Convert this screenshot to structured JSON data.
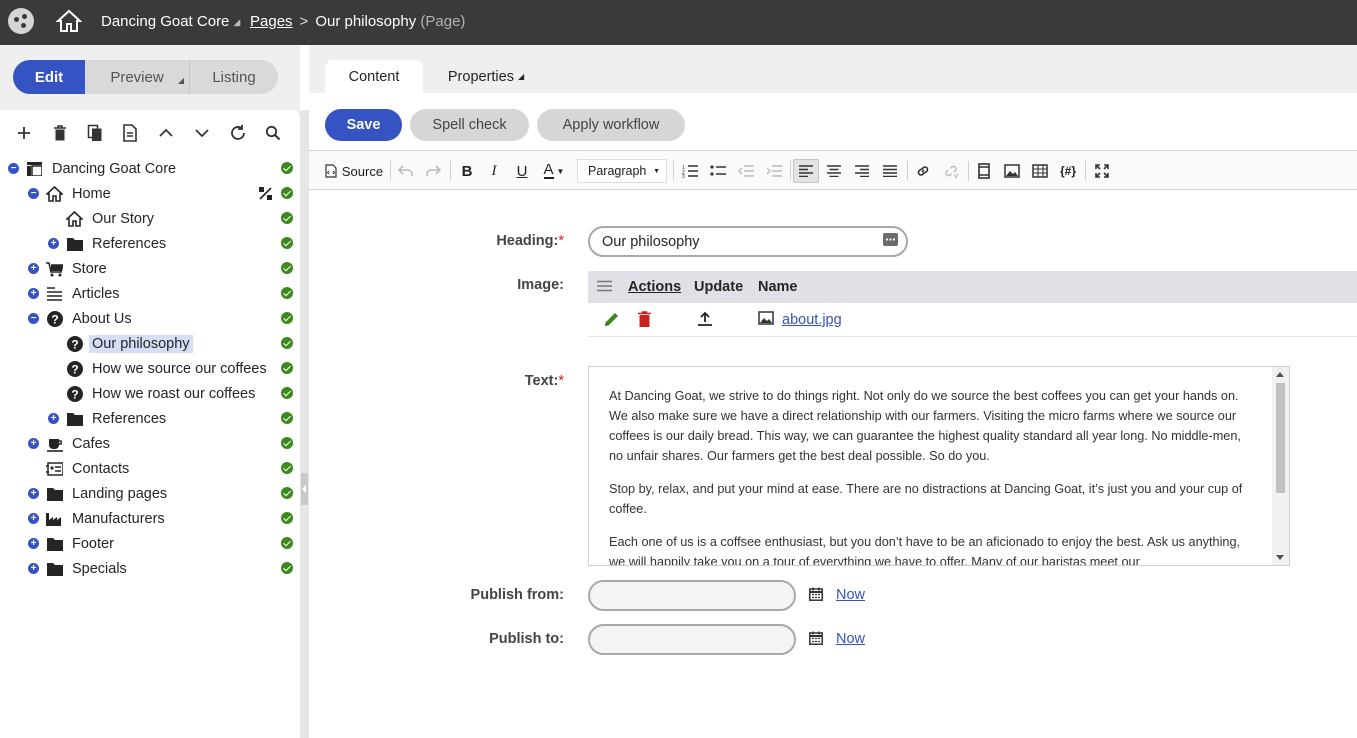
{
  "topbar": {
    "site_name": "Dancing Goat Core",
    "breadcrumb_pages": "Pages",
    "breadcrumb_current": "Our philosophy",
    "breadcrumb_kind": "(Page)"
  },
  "modes": {
    "edit": "Edit",
    "preview": "Preview",
    "listing": "Listing"
  },
  "tree": {
    "tools": [
      "plus-icon",
      "trash-icon",
      "copy-icon",
      "document-icon",
      "chevron-up-icon",
      "chevron-down-icon",
      "refresh-icon",
      "search-icon"
    ],
    "items": [
      {
        "label": "Dancing Goat Core",
        "icon": "site-icon"
      },
      {
        "label": "Home",
        "icon": "home-icon"
      },
      {
        "label": "Our Story",
        "icon": "home-icon"
      },
      {
        "label": "References",
        "icon": "folder-icon"
      },
      {
        "label": "Store",
        "icon": "cart-icon"
      },
      {
        "label": "Articles",
        "icon": "articles-icon"
      },
      {
        "label": "About Us",
        "icon": "question-icon"
      },
      {
        "label": "Our philosophy",
        "icon": "question-icon"
      },
      {
        "label": "How we source our coffees",
        "icon": "question-icon"
      },
      {
        "label": "How we roast our coffees",
        "icon": "question-icon"
      },
      {
        "label": "References",
        "icon": "folder-icon"
      },
      {
        "label": "Cafes",
        "icon": "coffee-icon"
      },
      {
        "label": "Contacts",
        "icon": "contacts-icon"
      },
      {
        "label": "Landing pages",
        "icon": "folder-icon"
      },
      {
        "label": "Manufacturers",
        "icon": "factory-icon"
      },
      {
        "label": "Footer",
        "icon": "folder-icon"
      },
      {
        "label": "Specials",
        "icon": "folder-icon"
      }
    ]
  },
  "tabs": {
    "content": "Content",
    "properties": "Properties"
  },
  "actions": {
    "save": "Save",
    "spell_check": "Spell check",
    "apply_workflow": "Apply workflow"
  },
  "editor_toolbar": {
    "source": "Source",
    "format": "Paragraph"
  },
  "form": {
    "heading_label": "Heading:",
    "heading_value": "Our philosophy",
    "image_label": "Image:",
    "image_columns": {
      "actions": "Actions",
      "update": "Update",
      "name": "Name"
    },
    "image_file": "about.jpg",
    "text_label": "Text:",
    "text_paragraphs": [
      "At Dancing Goat, we strive to do things right. Not only do we source the best coffees you can get your hands on. We also make sure we have a direct relationship with our farmers. Visiting the micro farms where we source our coffees is our daily bread. This way, we can guarantee the highest quality standard all year long. No middle-men, no unfair shares. Our farmers get the best deal possible. So do you.",
      "Stop by, relax, and put your mind at ease. There are no distractions at Dancing Goat, it’s just you and your cup of coffee.",
      "Each one of us is a coffsee enthusiast, but you don’t have to be an aficionado to enjoy the best. Ask us anything, we will happily take you on a tour of everything we have to offer. Many of our baristas meet our"
    ],
    "publish_from_label": "Publish from:",
    "publish_to_label": "Publish to:",
    "now_link": "Now",
    "required_mark": "*"
  },
  "colors": {
    "accent": "#3553c3",
    "topbar": "#3a3a3d",
    "success": "#3c8a1e",
    "danger": "#c8241d"
  }
}
